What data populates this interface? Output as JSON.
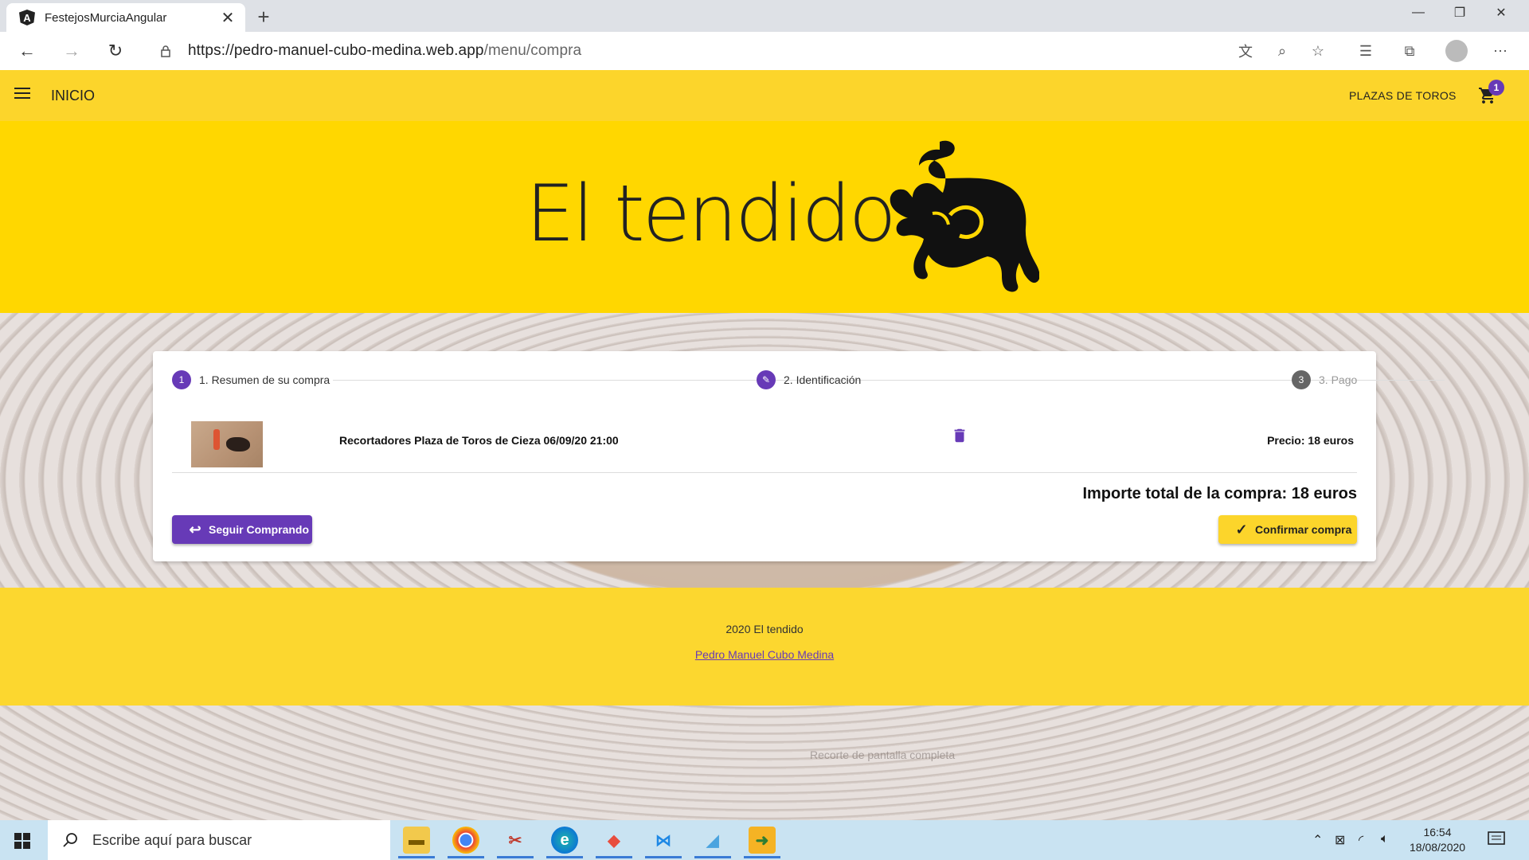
{
  "browser": {
    "tab_title": "FestejosMurciaAngular",
    "url_host": "https://pedro-manuel-cubo-medina.web.app",
    "url_path": "/menu/compra",
    "favicon_letter": "A"
  },
  "app": {
    "nav_title": "INICIO",
    "nav_link": "PLAZAS DE TOROS",
    "cart_count": "1",
    "brand": "El tendido",
    "accent_color": "#673ab7",
    "primary_color": "#fcd52b"
  },
  "stepper": {
    "steps": [
      {
        "number": "1",
        "label": "1. Resumen de su compra",
        "state": "active"
      },
      {
        "number": "",
        "label": "2. Identificación",
        "state": "edit"
      },
      {
        "number": "3",
        "label": "3. Pago",
        "state": "inactive"
      }
    ]
  },
  "cart_item": {
    "title": "Recortadores Plaza de Toros de Cieza 06/09/20 21:00",
    "price": "Precio: 18 euros"
  },
  "summary": {
    "total": "Importe total de la compra: 18 euros",
    "continue_label": "Seguir Comprando",
    "confirm_label": "Confirmar compra"
  },
  "footer": {
    "copyright": "2020 El tendido",
    "author": "Pedro Manuel Cubo Medina"
  },
  "overlay_hint": "Recorte de pantalla completa",
  "taskbar": {
    "search_placeholder": "Escribe aquí para buscar",
    "time": "16:54",
    "date": "18/08/2020"
  }
}
